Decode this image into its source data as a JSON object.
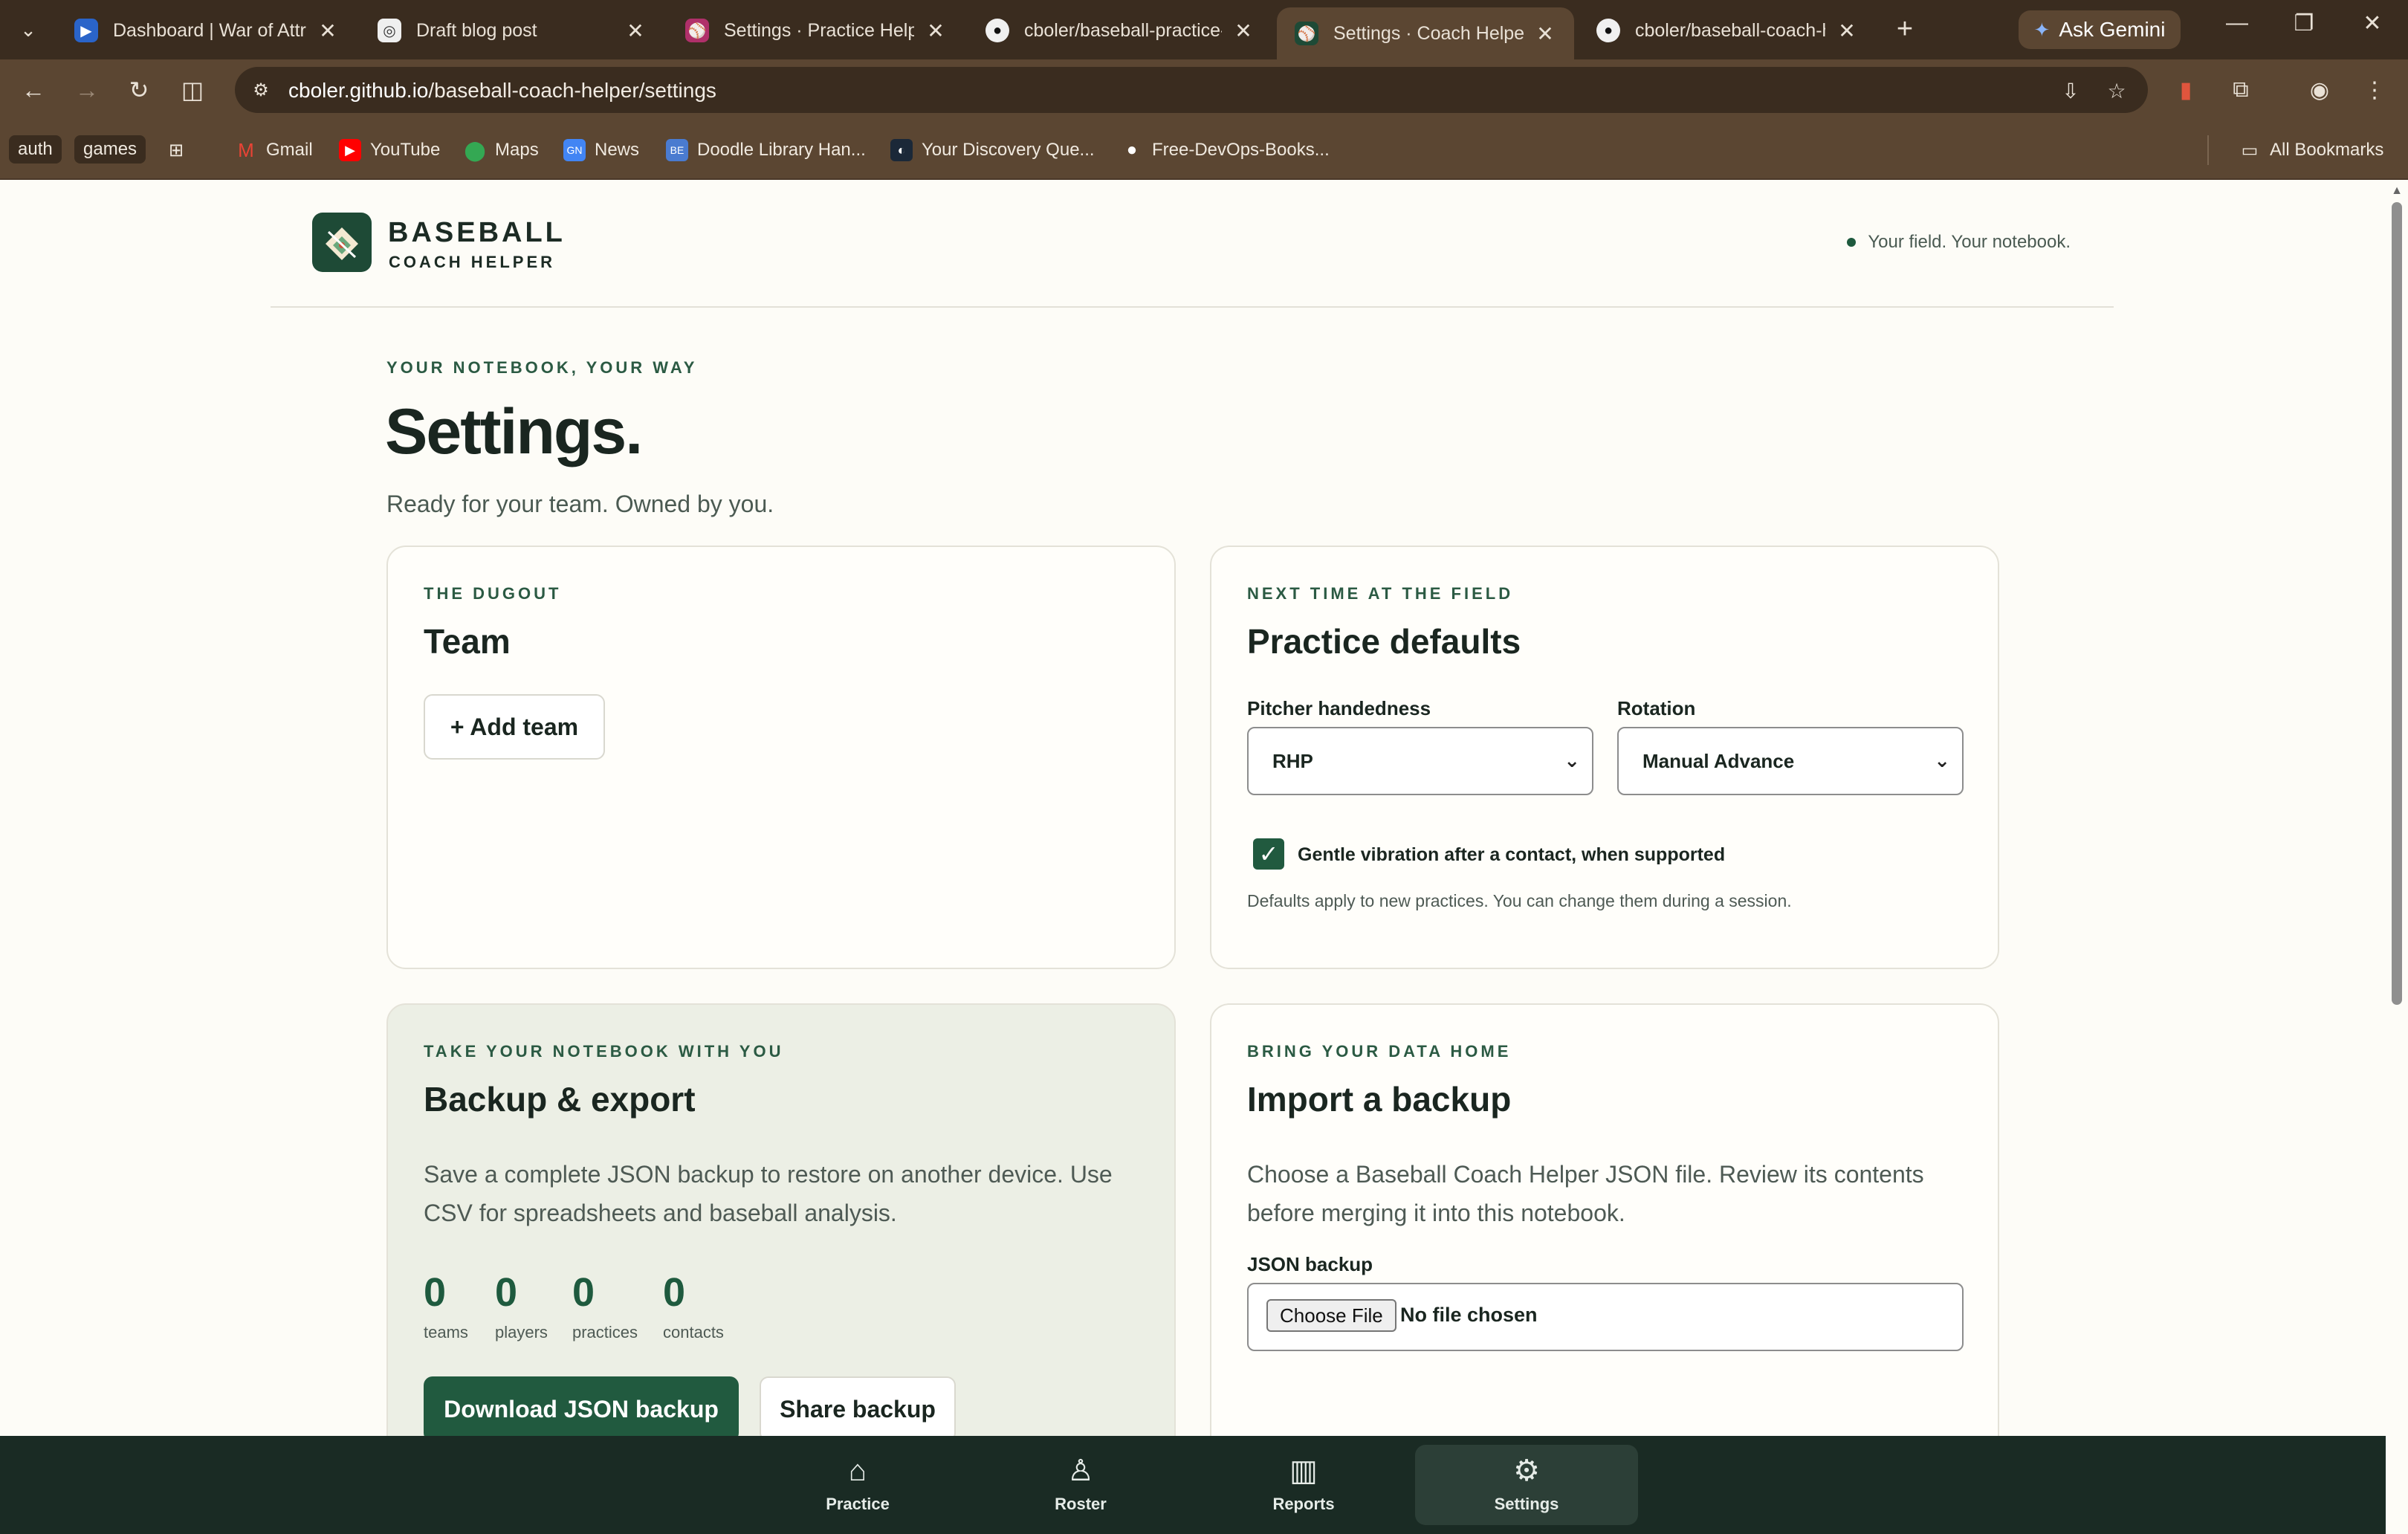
{
  "browser": {
    "tabs": [
      {
        "title": "Dashboard | War of Attrit",
        "favicon": "war-of-attrition-icon",
        "active": false
      },
      {
        "title": "Draft blog post",
        "favicon": "blog-icon",
        "active": false
      },
      {
        "title": "Settings · Practice Helper",
        "favicon": "practice-helper-icon",
        "active": false
      },
      {
        "title": "cboler/baseball-practice-",
        "favicon": "github-icon",
        "active": false
      },
      {
        "title": "Settings · Coach Helper",
        "favicon": "coach-helper-icon",
        "active": true
      },
      {
        "title": "cboler/baseball-coach-he",
        "favicon": "github-icon",
        "active": false
      }
    ],
    "gemini_label": "Ask Gemini",
    "url_host": "cboler.github.io",
    "url_path": "/baseball-coach-helper/settings",
    "bookmarks": {
      "pill_auth": "auth",
      "pill_games": "games",
      "items": [
        "Gmail",
        "YouTube",
        "Maps",
        "News",
        "Doodle Library Han...",
        "Your Discovery Que...",
        "Free-DevOps-Books..."
      ],
      "all_bookmarks": "All Bookmarks"
    }
  },
  "header": {
    "brand_line1": "BASEBALL",
    "brand_line2": "COACH HELPER",
    "tagline": "Your field. Your notebook."
  },
  "hero": {
    "eyebrow": "YOUR NOTEBOOK, YOUR WAY",
    "title": "Settings.",
    "subtitle": "Ready for your team. Owned by you."
  },
  "team_card": {
    "eyebrow": "THE DUGOUT",
    "title": "Team",
    "add_button": "+ Add team"
  },
  "practice_card": {
    "eyebrow": "NEXT TIME AT THE FIELD",
    "title": "Practice defaults",
    "pitcher_label": "Pitcher handedness",
    "pitcher_value": "RHP",
    "rotation_label": "Rotation",
    "rotation_value": "Manual Advance",
    "vibration_label": "Gentle vibration after a contact, when supported",
    "vibration_checked": true,
    "note": "Defaults apply to new practices. You can change them during a session."
  },
  "backup_card": {
    "eyebrow": "TAKE YOUR NOTEBOOK WITH YOU",
    "title": "Backup & export",
    "body": "Save a complete JSON backup to restore on another device. Use CSV for spreadsheets and baseball analysis.",
    "stats": [
      {
        "value": "0",
        "label": "teams"
      },
      {
        "value": "0",
        "label": "players"
      },
      {
        "value": "0",
        "label": "practices"
      },
      {
        "value": "0",
        "label": "contacts"
      }
    ],
    "download_button": "Download JSON backup",
    "share_button": "Share backup"
  },
  "import_card": {
    "eyebrow": "BRING YOUR DATA HOME",
    "title": "Import a backup",
    "body": "Choose a Baseball Coach Helper JSON file. Review its contents before merging it into this notebook.",
    "file_label": "JSON backup",
    "choose_button": "Choose File",
    "file_status": "No file chosen"
  },
  "bottom_nav": {
    "items": [
      {
        "label": "Practice",
        "icon": "home-icon",
        "active": false
      },
      {
        "label": "Roster",
        "icon": "player-icon",
        "active": false
      },
      {
        "label": "Reports",
        "icon": "bars-icon",
        "active": false
      },
      {
        "label": "Settings",
        "icon": "gear-icon",
        "active": true
      }
    ]
  },
  "colors": {
    "accent": "#215a3f",
    "nav_bg": "#1a2b24",
    "chrome": "#5b4632"
  }
}
